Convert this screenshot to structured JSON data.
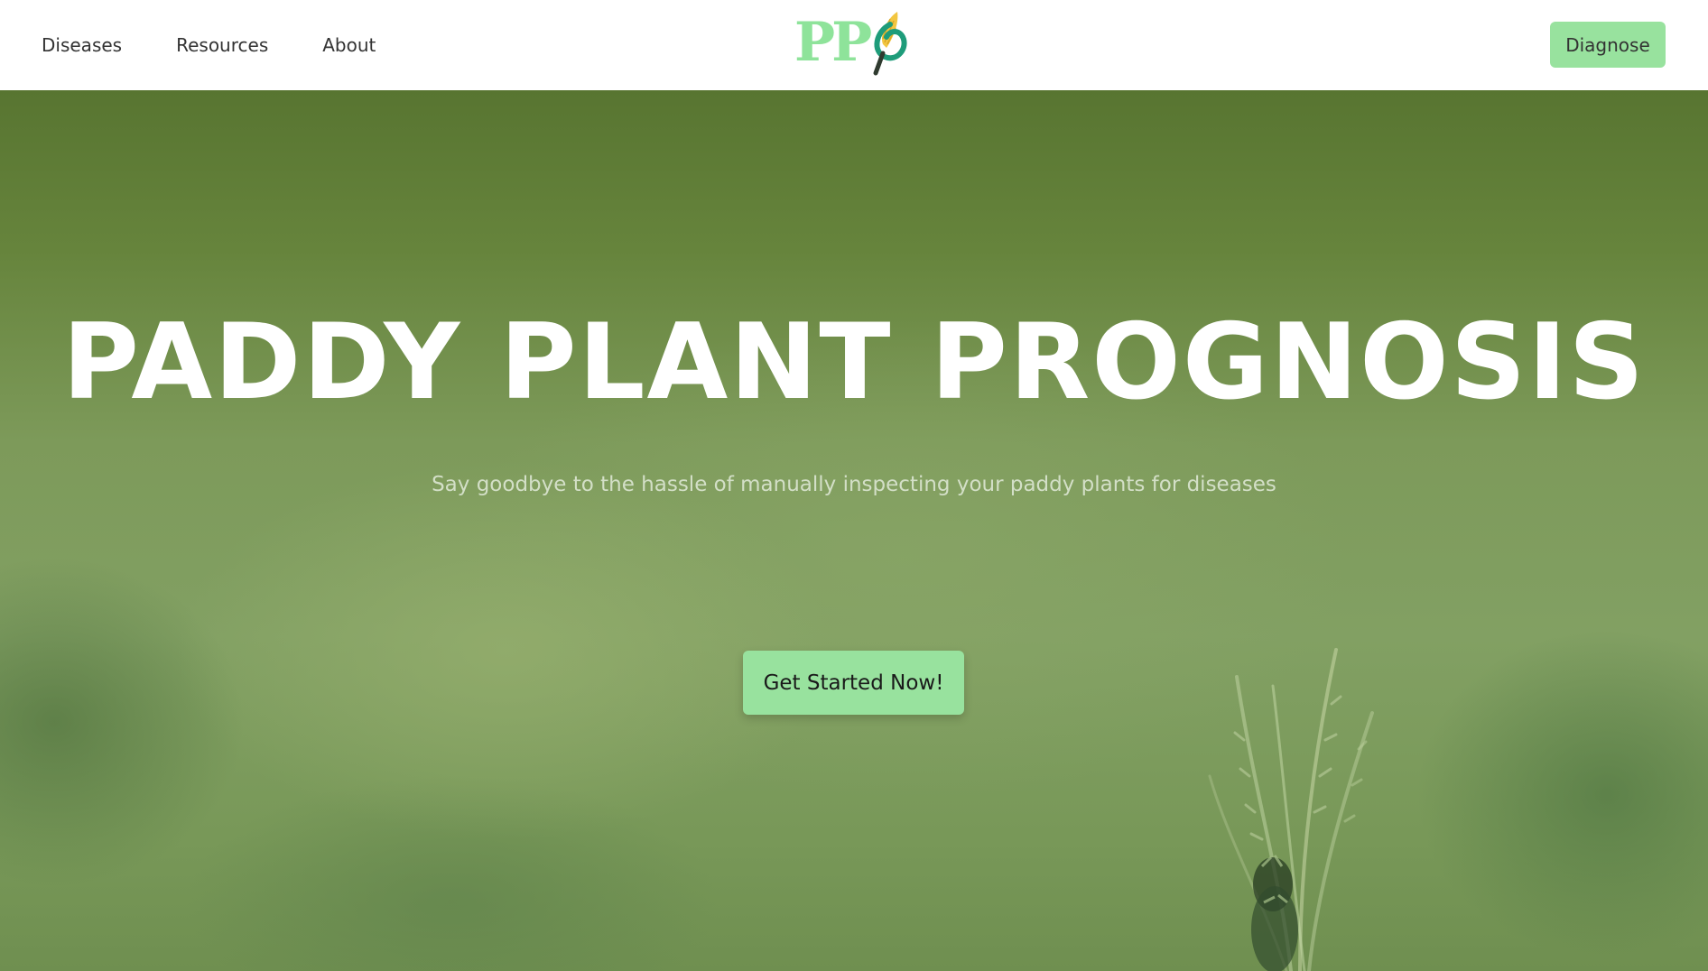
{
  "nav": {
    "links": [
      {
        "label": "Diseases"
      },
      {
        "label": "Resources"
      },
      {
        "label": "About"
      }
    ],
    "logo_text": "PP",
    "diagnose_label": "Diagnose"
  },
  "hero": {
    "title": "PADDY PLANT PROGNOSIS",
    "subtitle": "Say goodbye to the hassle of manually inspecting your paddy plants for diseases",
    "cta_label": "Get Started Now!"
  },
  "colors": {
    "accent": "#98e29e",
    "logo_green": "#8ee39a",
    "logo_teal": "#1e9c7a",
    "logo_yellow": "#f2c641",
    "hero_green": "#7d9a5a"
  },
  "icons": {
    "logo_mark": "corn-cob-leaf-icon"
  }
}
